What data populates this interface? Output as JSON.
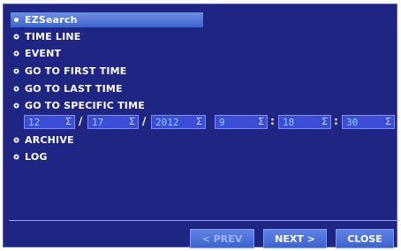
{
  "menu": {
    "items": [
      {
        "label": "EZSearch",
        "selected": true
      },
      {
        "label": "TIME LINE",
        "selected": false
      },
      {
        "label": "EVENT",
        "selected": false
      },
      {
        "label": "GO TO FIRST TIME",
        "selected": false
      },
      {
        "label": "GO TO LAST TIME",
        "selected": false
      },
      {
        "label": "GO TO SPECIFIC TIME",
        "selected": false
      },
      {
        "label": "ARCHIVE",
        "selected": false
      },
      {
        "label": "LOG",
        "selected": false
      }
    ]
  },
  "specific_time": {
    "month": "12",
    "day": "17",
    "year": "2012",
    "hour": "9",
    "minute": "18",
    "second": "30",
    "date_separator": "/",
    "time_separator": ":",
    "spin_icon": "Σ"
  },
  "buttons": {
    "prev": "< PREV",
    "next": "NEXT >",
    "close": "CLOSE"
  },
  "colors": {
    "background": "#1f2583",
    "selected": "#3e63cf",
    "field": "#3c4ed8",
    "field_text": "#8fd2ff"
  }
}
